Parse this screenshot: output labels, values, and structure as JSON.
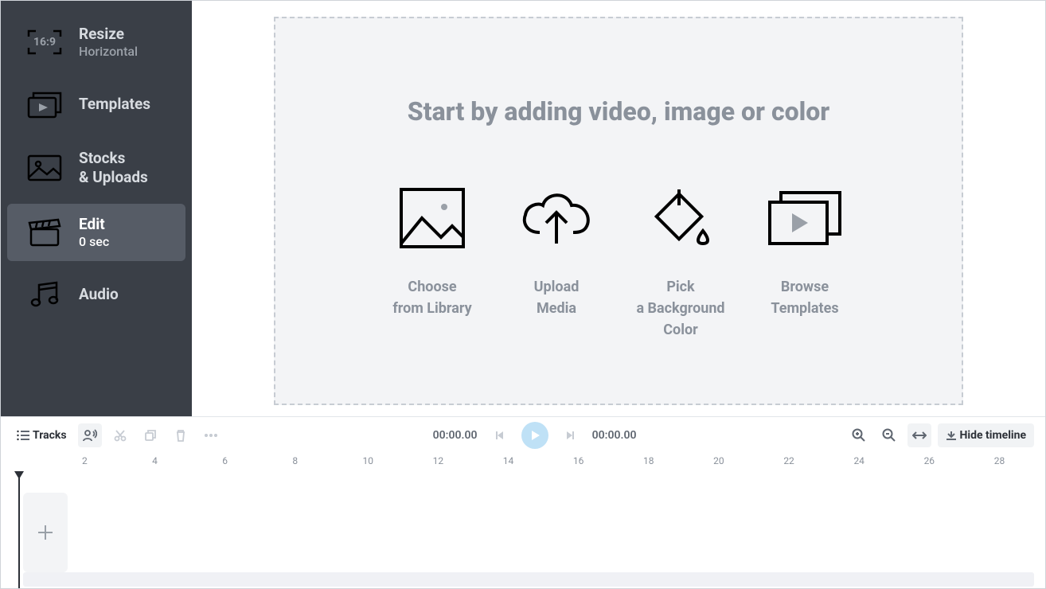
{
  "sidebar": {
    "resize": {
      "title": "Resize",
      "sub": "Horizontal",
      "ratio": "16:9"
    },
    "templates": {
      "title": "Templates"
    },
    "stocks": {
      "title": "Stocks",
      "sub": "& Uploads"
    },
    "edit": {
      "title": "Edit",
      "sub": "0 sec"
    },
    "audio": {
      "title": "Audio"
    }
  },
  "dropzone": {
    "heading": "Start by adding video, image or color",
    "choose": "Choose\nfrom Library",
    "upload": "Upload\nMedia",
    "bgcolor": "Pick\na Background\nColor",
    "browse": "Browse\nTemplates"
  },
  "toolbar": {
    "tracks_label": "Tracks",
    "current_time": "00:00.00",
    "total_time": "00:00.00",
    "hide_label": "Hide timeline"
  },
  "ruler_marks": [
    2,
    4,
    6,
    8,
    10,
    12,
    14,
    16,
    18,
    20,
    22,
    24,
    26,
    28
  ]
}
